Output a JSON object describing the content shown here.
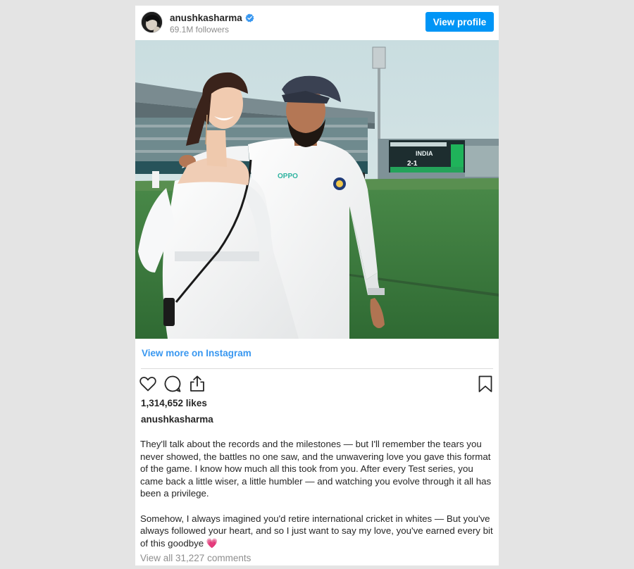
{
  "post": {
    "username": "anushkasharma",
    "followers": "69.1M followers",
    "view_profile_label": "View profile",
    "view_more_label": "View more on Instagram",
    "likes": "1,314,652 likes",
    "caption_username": "anushkasharma",
    "caption_paragraphs": [
      "They'll talk about the records and the milestones — but I'll remember the tears you never showed, the battles no one saw, and the unwavering love you gave this format of the game. I know how much all this took from you. After every Test series, you came back a little wiser, a little humbler — and watching you evolve through it all has been a privilege.",
      "Somehow, I always imagined you'd retire international cricket in whites — But you've always followed your heart, and so I just want to say my love, you've earned every bit of this goodbye"
    ],
    "heart_emoji": "💗",
    "comments_link": "View all 31,227 comments"
  },
  "photo": {
    "jersey_sponsor": "OPPO",
    "scoreboard_score": "2-1",
    "scoreboard_team": "INDIA"
  },
  "colors": {
    "accent": "#0095f6",
    "link": "#3897f0",
    "verified": "#3897f0",
    "heart": "#e0245e"
  },
  "icons": {
    "like": "heart-outline-icon",
    "comment": "comment-bubble-icon",
    "share": "share-icon",
    "save": "bookmark-icon",
    "verified": "verified-badge-icon"
  }
}
